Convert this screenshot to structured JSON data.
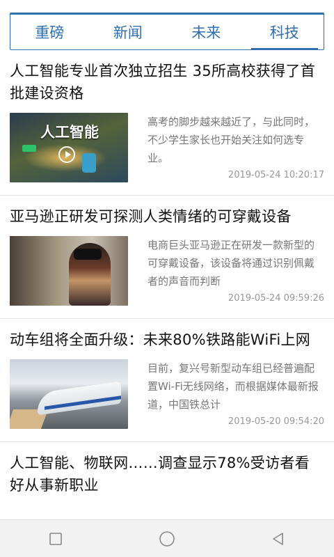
{
  "tabs": [
    {
      "label": "重磅",
      "active": false
    },
    {
      "label": "新闻",
      "active": false
    },
    {
      "label": "未来",
      "active": false
    },
    {
      "label": "科技",
      "active": true
    }
  ],
  "articles": [
    {
      "title": "人工智能专业首次独立招生 35所高校获得了首批建设资格",
      "summary": "高考的脚步越来越近了，与此同时，不少学生家长也开始关注如何选专业。",
      "time": "2019-05-24 10:20:17",
      "thumb_text": "人工智能",
      "thumb_icon": "ai-video-thumbnail"
    },
    {
      "title": "亚马逊正研发可探测人类情绪的可穿戴设备",
      "summary": "电商巨头亚马逊正在研发一款新型的可穿戴设备，该设备将通过识别佩戴者的声音而判断",
      "time": "2019-05-24 09:59:26",
      "thumb_icon": "vr-headset-photo"
    },
    {
      "title": "动车组将全面升级：未来80%铁路能WiFi上网",
      "summary": "目前，复兴号新型动车组已经普遍配置Wi-Fi无线网络，而根据媒体最新报道，中国铁总计",
      "time": "2019-05-20 09:54:20",
      "thumb_icon": "bullet-train-photo"
    },
    {
      "title": "人工智能、物联网……调查显示78%受访者看好从事新职业"
    }
  ],
  "navbar": {
    "icons": [
      "recent-apps-icon",
      "home-icon",
      "back-icon"
    ]
  },
  "colors": {
    "accent": "#2f6fb0",
    "summary": "#777777",
    "time": "#999999"
  }
}
